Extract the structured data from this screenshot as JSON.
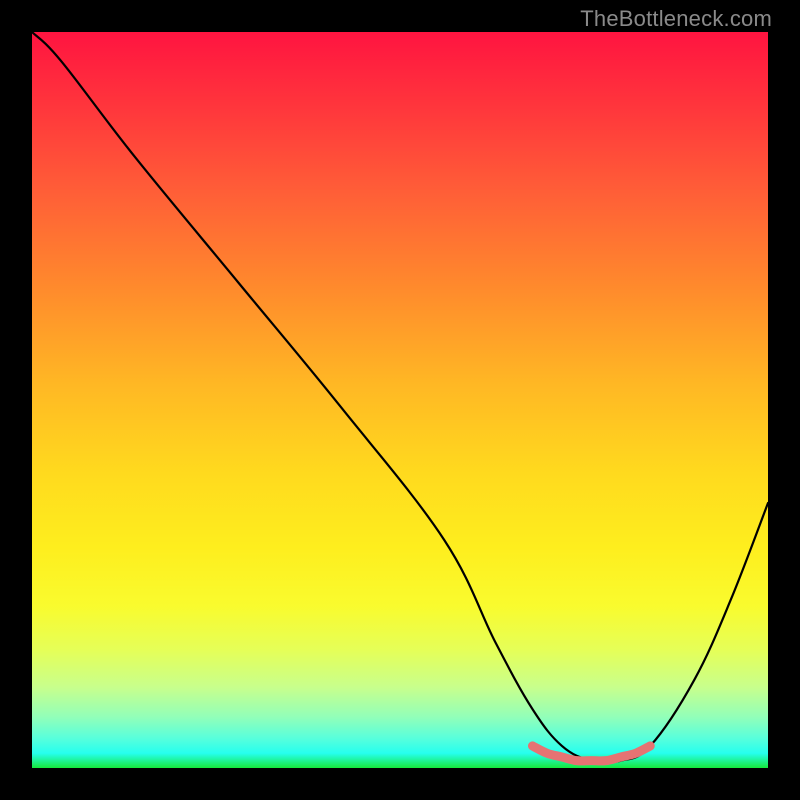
{
  "watermark": "TheBottleneck.com",
  "chart_data": {
    "type": "line",
    "title": "",
    "xlabel": "",
    "ylabel": "",
    "xlim": [
      0,
      100
    ],
    "ylim": [
      0,
      100
    ],
    "series": [
      {
        "name": "bottleneck-curve",
        "x": [
          0,
          4,
          14,
          28,
          42,
          56,
          63,
          68,
          72,
          76,
          80,
          84,
          90,
          95,
          100
        ],
        "values": [
          100,
          96,
          83,
          66,
          49,
          31,
          17,
          8,
          3,
          1,
          1,
          3,
          12,
          23,
          36
        ]
      },
      {
        "name": "optimal-marker",
        "x": [
          68,
          70,
          72,
          74,
          76,
          78,
          80,
          82,
          84
        ],
        "values": [
          3,
          2,
          1.5,
          1,
          1,
          1,
          1.5,
          2,
          3
        ]
      }
    ],
    "background_gradient": {
      "top": "#ff1440",
      "mid": "#ffe81e",
      "bottom": "#16e83c"
    },
    "curve_color": "#000000",
    "marker_color": "#e57373"
  }
}
